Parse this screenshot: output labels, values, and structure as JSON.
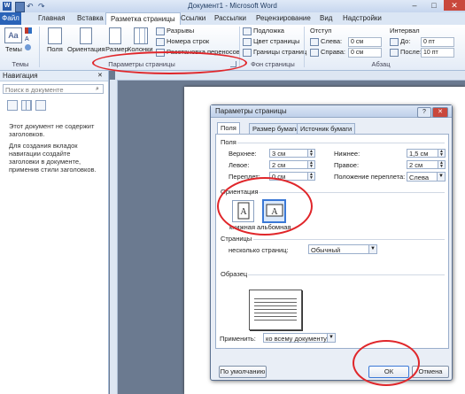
{
  "window": {
    "title": "Документ1 - Microsoft Word",
    "buttons": [
      "–",
      "□",
      "✕"
    ]
  },
  "tabs": [
    "Файл",
    "Главная",
    "Вставка",
    "Разметка страницы",
    "Ссылки",
    "Рассылки",
    "Рецензирование",
    "Вид",
    "Надстройки"
  ],
  "ribbon": {
    "themes": {
      "label": "Темы",
      "group": "Темы"
    },
    "page_setup": {
      "fields": "Поля",
      "orientation": "Ориентация",
      "size": "Размер",
      "columns": "Колонки",
      "breaks": "Разрывы",
      "line_numbers": "Номера строк",
      "hyphenation": "Расстановка переносов",
      "group": "Параметры страницы"
    },
    "background": {
      "watermark": "Подложка",
      "page_color": "Цвет страницы",
      "page_borders": "Границы страниц",
      "group": "Фон страницы"
    },
    "paragraph": {
      "indent_title": "Отступ",
      "left_label": "Слева:",
      "left_value": "0 см",
      "right_label": "Справа:",
      "right_value": "0 см",
      "spacing_title": "Интервал",
      "before_label": "До:",
      "before_value": "0 пт",
      "after_label": "После:",
      "after_value": "10 пт",
      "group": "Абзац"
    }
  },
  "nav": {
    "title": "Навигация",
    "close": "✕",
    "search_placeholder": "Поиск в документе",
    "message1": "Этот документ не содержит заголовков.",
    "message2": "Для создания вкладок навигации создайте заголовки в документе, применив стили заголовков."
  },
  "dialog": {
    "title": "Параметры страницы",
    "help": "?",
    "close": "✕",
    "tabs": [
      "Поля",
      "Размер бумаги",
      "Источник бумаги"
    ],
    "margins_section": "Поля",
    "top_label": "Верхнее:",
    "top_value": "3 см",
    "bottom_label": "Нижнее:",
    "bottom_value": "1,5 см",
    "left_label": "Левое:",
    "left_value": "2 см",
    "right_label": "Правое:",
    "right_value": "2 см",
    "gutter_label": "Переплет:",
    "gutter_value": "0 см",
    "gutter_pos_label": "Положение переплета:",
    "gutter_pos_value": "Слева",
    "orientation_section": "Ориентация",
    "portrait": "книжная",
    "landscape": "альбомная",
    "pages_section": "Страницы",
    "multiple_pages_label": "несколько страниц:",
    "multiple_pages_value": "Обычный",
    "preview_section": "Образец",
    "apply_label": "Применить:",
    "apply_value": "ко всему документу",
    "default_button": "По умолчанию",
    "ok_button": "ОК",
    "cancel_button": "Отмена"
  },
  "colors": {
    "file_tab": "#2a63b8",
    "highlight": "#e0262a",
    "accent": "#3a78d6"
  }
}
